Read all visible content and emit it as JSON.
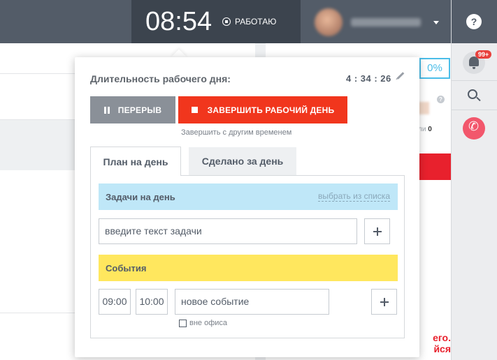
{
  "header": {
    "clock": "08:54",
    "status": "РАБОТАЮ"
  },
  "right_panel": {
    "help": "?",
    "notifications_badge": "99+"
  },
  "background": {
    "percent": "0%",
    "card_text": "ли",
    "card_count": "0",
    "red_text_1": "его.",
    "red_text_2": "йся"
  },
  "workday": {
    "duration_label": "Длительность рабочего дня:",
    "duration_value": "4 : 34 : 26",
    "pause_button": "ПЕРЕРЫВ",
    "finish_button": "ЗАВЕРШИТЬ РАБОЧИЙ ДЕНЬ",
    "finish_other_time": "Завершить с другим временем",
    "tabs": [
      {
        "label": "План на день"
      },
      {
        "label": "Сделано за день"
      }
    ],
    "tasks": {
      "title": "Задачи на день",
      "select_link": "выбрать из списка",
      "input_placeholder": "введите текст задачи"
    },
    "events": {
      "title": "События",
      "time_from": "09:00",
      "time_to": "10:00",
      "name_placeholder": "новое событие",
      "out_of_office": "вне офиса"
    }
  },
  "colors": {
    "accent_red": "#f1361d",
    "tasks_bg": "#bfe7f8",
    "events_bg": "#ffe75e",
    "header_bg": "#535c68"
  }
}
